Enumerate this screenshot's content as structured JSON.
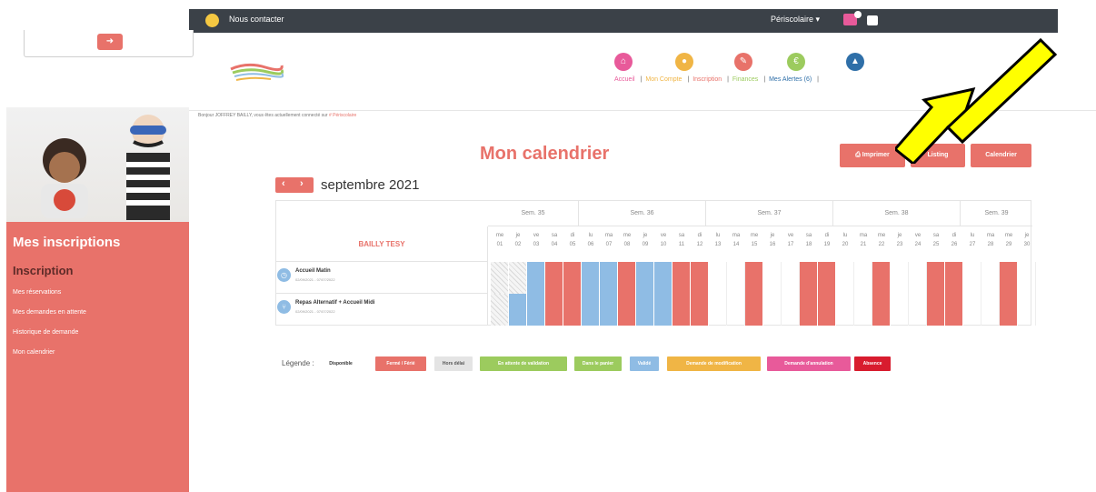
{
  "topbar": {
    "contact_label": "Nous contacter",
    "user_menu": "Périscolaire ▾",
    "cart_count": ""
  },
  "nav": {
    "items": [
      {
        "label": "Accueil",
        "color": "#e85a9a",
        "icon": "home-icon"
      },
      {
        "label": "Mon Compte",
        "color": "#f0b545",
        "icon": "user-icon"
      },
      {
        "label": "Inscription",
        "color": "#e8726a",
        "icon": "pencil-icon"
      },
      {
        "label": "Finances",
        "color": "#9ccb5e",
        "icon": "euro-icon"
      },
      {
        "label": "Mes Alertes (6)",
        "color": "#2f6fa8",
        "icon": "alert-icon"
      }
    ]
  },
  "greeting": {
    "text": "Bonjour JOFFREY BAILLY, vous êtes actuellement connecté sur",
    "context": "# Périscolaire"
  },
  "sidebar": {
    "title": "Mes inscriptions",
    "subtitle": "Inscription",
    "items": [
      "Mes réservations",
      "Mes demandes en attente",
      "Historique de demande",
      "Mon calendrier"
    ]
  },
  "page": {
    "title": "Mon calendrier",
    "buttons": {
      "print": "⎙ Imprimer",
      "listing": "Listing",
      "calendar": "Calendrier"
    },
    "month": "septembre 2021"
  },
  "calendar": {
    "child_name": "BAILLY TESY",
    "weeks": [
      {
        "label": "Sem. 35",
        "days": 5
      },
      {
        "label": "Sem. 36",
        "days": 7
      },
      {
        "label": "Sem. 37",
        "days": 7
      },
      {
        "label": "Sem. 38",
        "days": 7
      },
      {
        "label": "Sem. 39",
        "days": 4
      }
    ],
    "days": [
      {
        "dow": "me",
        "num": "01"
      },
      {
        "dow": "je",
        "num": "02"
      },
      {
        "dow": "ve",
        "num": "03"
      },
      {
        "dow": "sa",
        "num": "04"
      },
      {
        "dow": "di",
        "num": "05"
      },
      {
        "dow": "lu",
        "num": "06"
      },
      {
        "dow": "ma",
        "num": "07"
      },
      {
        "dow": "me",
        "num": "08"
      },
      {
        "dow": "je",
        "num": "09"
      },
      {
        "dow": "ve",
        "num": "10"
      },
      {
        "dow": "sa",
        "num": "11"
      },
      {
        "dow": "di",
        "num": "12"
      },
      {
        "dow": "lu",
        "num": "13"
      },
      {
        "dow": "ma",
        "num": "14"
      },
      {
        "dow": "me",
        "num": "15"
      },
      {
        "dow": "je",
        "num": "16"
      },
      {
        "dow": "ve",
        "num": "17"
      },
      {
        "dow": "sa",
        "num": "18"
      },
      {
        "dow": "di",
        "num": "19"
      },
      {
        "dow": "lu",
        "num": "20"
      },
      {
        "dow": "ma",
        "num": "21"
      },
      {
        "dow": "me",
        "num": "22"
      },
      {
        "dow": "je",
        "num": "23"
      },
      {
        "dow": "ve",
        "num": "24"
      },
      {
        "dow": "sa",
        "num": "25"
      },
      {
        "dow": "di",
        "num": "26"
      },
      {
        "dow": "lu",
        "num": "27"
      },
      {
        "dow": "ma",
        "num": "28"
      },
      {
        "dow": "me",
        "num": "29"
      },
      {
        "dow": "je",
        "num": "30"
      }
    ],
    "rows": [
      {
        "name": "Accueil Matin",
        "dates": "02/09/2021 - 07/07/2022",
        "icon": "clock-icon",
        "cells": [
          "h",
          "h",
          "b",
          "r",
          "r",
          "b",
          "b",
          "r",
          "b",
          "b",
          "r",
          "r",
          "",
          "",
          "r",
          "",
          "",
          "r",
          "r",
          "",
          "",
          "r",
          "",
          "",
          "r",
          "r",
          "",
          "",
          "r",
          ""
        ]
      },
      {
        "name": "Repas Alternatif + Accueil Midi",
        "dates": "02/09/2021 - 07/07/2022",
        "icon": "fork-knife-icon",
        "cells": [
          "h",
          "b",
          "b",
          "r",
          "r",
          "b",
          "b",
          "r",
          "b",
          "b",
          "r",
          "r",
          "",
          "",
          "r",
          "",
          "",
          "r",
          "r",
          "",
          "",
          "r",
          "",
          "",
          "r",
          "r",
          "",
          "",
          "r",
          ""
        ]
      }
    ]
  },
  "legend": {
    "label": "Légende :",
    "items": [
      {
        "label": "Disponible",
        "color": "#ffffff",
        "text": "#333333"
      },
      {
        "label": "Fermé / Férié",
        "color": "#e8726a",
        "text": "#ffffff"
      },
      {
        "label": "Hors délai",
        "color": "#e4e4e4",
        "text": "#555555"
      },
      {
        "label": "En attente de validation",
        "color": "#9ccb5e",
        "text": "#ffffff"
      },
      {
        "label": "Dans le panier",
        "color": "#9ccb5e",
        "text": "#ffffff"
      },
      {
        "label": "Validé",
        "color": "#8fbce4",
        "text": "#ffffff"
      },
      {
        "label": "Demande de modification",
        "color": "#f0b545",
        "text": "#ffffff"
      },
      {
        "label": "Demande d'annulation",
        "color": "#e85a9a",
        "text": "#ffffff"
      },
      {
        "label": "Absence",
        "color": "#d81c2e",
        "text": "#ffffff"
      }
    ]
  },
  "colors": {
    "accent": "#e8726a",
    "validated": "#8fbce4",
    "hatched": "#dcdcdc",
    "arrow": "#ffff00"
  }
}
